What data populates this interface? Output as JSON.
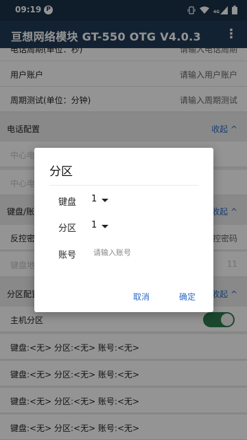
{
  "status_bar": {
    "time": "09:19",
    "p_badge": "P",
    "icons": [
      "vibrate-icon",
      "wifi-icon",
      "signal-4g-icon",
      "signal-icon",
      "battery-icon"
    ],
    "network_type": "4G"
  },
  "app_bar": {
    "title": "亘想网络模块 GT-550 OTG V4.0.3",
    "menu_icon": "more-vert-icon"
  },
  "settings": {
    "partial_row": {
      "label": "电话周期(单位：秒)",
      "value": "请输入电话周期"
    },
    "user_account": {
      "label": "用户账户",
      "value": "请输入用户账户"
    },
    "cycle_test": {
      "label": "周期测试(单位：分钟)",
      "value": "请输入周期测试"
    },
    "phone_section": {
      "label": "电话配置",
      "collapse": "收起 ^"
    },
    "center1": {
      "label": "中心电话1"
    },
    "center2": {
      "label": "中心电话2"
    },
    "keyboard_section": {
      "label": "键盘/账号配置",
      "collapse": "收起 ^"
    },
    "reverse": {
      "label": "反控密码",
      "value": "请输入反控密码"
    },
    "kbaddr": {
      "label": "键盘地址",
      "value": "11"
    },
    "partition_section": {
      "label": "分区配置",
      "collapse": "收起 ^"
    },
    "host_partition": {
      "label": "主机分区",
      "toggle_on": true
    },
    "kb_rows": [
      "键盘:<无> 分区:<无> 账号:<无>",
      "键盘:<无> 分区:<无> 账号:<无>",
      "键盘:<无> 分区:<无> 账号:<无>",
      "键盘:<无> 分区:<无> 账号:<无>"
    ]
  },
  "dialog": {
    "title": "分区",
    "keyboard": {
      "label": "键盘",
      "value": "1"
    },
    "partition": {
      "label": "分区",
      "value": "1"
    },
    "account": {
      "label": "账号",
      "placeholder": "请输入账号",
      "value": ""
    },
    "cancel": "取消",
    "confirm": "确定"
  },
  "colors": {
    "status_bar": "#1b3149",
    "app_bar": "#213b58",
    "accent": "#2b6bc4",
    "toggle": "#2e7d4f"
  }
}
